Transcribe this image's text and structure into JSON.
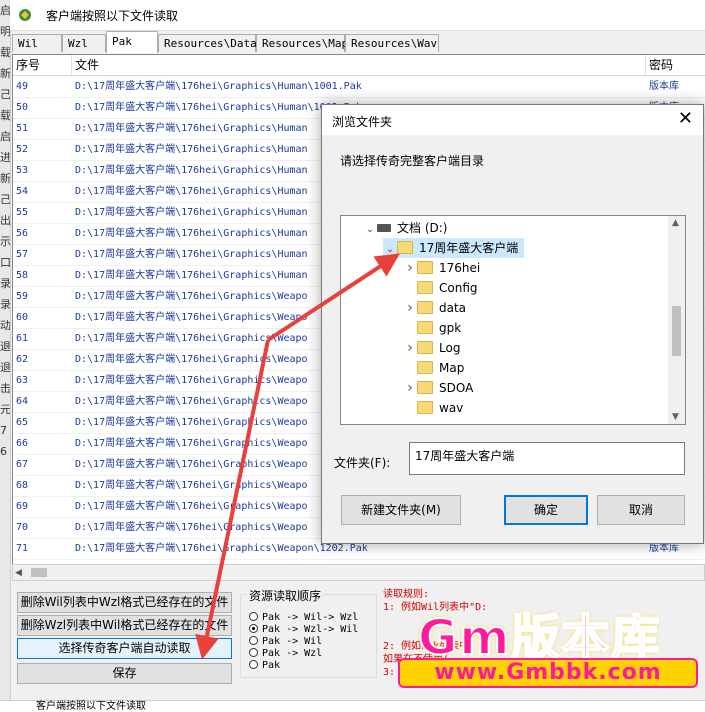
{
  "window": {
    "title": "客户端按照以下文件读取"
  },
  "left_fragments": [
    "启",
    "明",
    "载",
    "新",
    "己",
    "载",
    "启",
    "进",
    "新",
    "己",
    "出",
    "示",
    "口",
    "录",
    "录",
    "动",
    "退",
    "退",
    "击",
    "元",
    "7",
    "6"
  ],
  "tabs": [
    {
      "label": "Wil",
      "active": false
    },
    {
      "label": "Wzl",
      "active": false
    },
    {
      "label": "Pak",
      "active": true
    },
    {
      "label": "Resources\\Data",
      "active": false
    },
    {
      "label": "Resources\\Map",
      "active": false
    },
    {
      "label": "Resources\\Wav",
      "active": false
    }
  ],
  "grid": {
    "columns": [
      "序号",
      "文件",
      "密码"
    ],
    "rows": [
      {
        "no": "49",
        "file": "D:\\17周年盛大客户端\\176hei\\Graphics\\Human\\1001.Pak",
        "pwd": "版本库"
      },
      {
        "no": "50",
        "file": "D:\\17周年盛大客户端\\176hei\\Graphics\\Human\\1002.Pak",
        "pwd": "版本库"
      },
      {
        "no": "51",
        "file": "D:\\17周年盛大客户端\\176hei\\Graphics\\Human",
        "pwd": ""
      },
      {
        "no": "52",
        "file": "D:\\17周年盛大客户端\\176hei\\Graphics\\Human",
        "pwd": ""
      },
      {
        "no": "53",
        "file": "D:\\17周年盛大客户端\\176hei\\Graphics\\Human",
        "pwd": ""
      },
      {
        "no": "54",
        "file": "D:\\17周年盛大客户端\\176hei\\Graphics\\Human",
        "pwd": ""
      },
      {
        "no": "55",
        "file": "D:\\17周年盛大客户端\\176hei\\Graphics\\Human",
        "pwd": ""
      },
      {
        "no": "56",
        "file": "D:\\17周年盛大客户端\\176hei\\Graphics\\Human",
        "pwd": ""
      },
      {
        "no": "57",
        "file": "D:\\17周年盛大客户端\\176hei\\Graphics\\Human",
        "pwd": ""
      },
      {
        "no": "58",
        "file": "D:\\17周年盛大客户端\\176hei\\Graphics\\Human",
        "pwd": ""
      },
      {
        "no": "59",
        "file": "D:\\17周年盛大客户端\\176hei\\Graphics\\Weapo",
        "pwd": ""
      },
      {
        "no": "60",
        "file": "D:\\17周年盛大客户端\\176hei\\Graphics\\Weapo",
        "pwd": ""
      },
      {
        "no": "61",
        "file": "D:\\17周年盛大客户端\\176hei\\Graphics\\Weapo",
        "pwd": ""
      },
      {
        "no": "62",
        "file": "D:\\17周年盛大客户端\\176hei\\Graphics\\Weapo",
        "pwd": ""
      },
      {
        "no": "63",
        "file": "D:\\17周年盛大客户端\\176hei\\Graphics\\Weapo",
        "pwd": ""
      },
      {
        "no": "64",
        "file": "D:\\17周年盛大客户端\\176hei\\Graphics\\Weapo",
        "pwd": ""
      },
      {
        "no": "65",
        "file": "D:\\17周年盛大客户端\\176hei\\Graphics\\Weapo",
        "pwd": ""
      },
      {
        "no": "66",
        "file": "D:\\17周年盛大客户端\\176hei\\Graphics\\Weapo",
        "pwd": ""
      },
      {
        "no": "67",
        "file": "D:\\17周年盛大客户端\\176hei\\Graphics\\Weapo",
        "pwd": ""
      },
      {
        "no": "68",
        "file": "D:\\17周年盛大客户端\\176hei\\Graphics\\Weapo",
        "pwd": ""
      },
      {
        "no": "69",
        "file": "D:\\17周年盛大客户端\\176hei\\Graphics\\Weapo",
        "pwd": ""
      },
      {
        "no": "70",
        "file": "D:\\17周年盛大客户端\\176hei\\Graphics\\Weapo",
        "pwd": ""
      },
      {
        "no": "71",
        "file": "D:\\17周年盛大客户端\\176hei\\Graphics\\Weapon\\1202.Pak",
        "pwd": "版本库"
      }
    ]
  },
  "buttons": {
    "delete_wil": "删除Wil列表中Wzl格式已经存在的文件",
    "delete_wzl": "删除Wzl列表中Wil格式已经存在的文件",
    "auto_read": "选择传奇客户端自动读取",
    "save": "保存"
  },
  "resource_order": {
    "title": "资源读取顺序",
    "options": [
      {
        "label": "Pak -> Wil-> Wzl",
        "checked": false
      },
      {
        "label": "Pak -> Wzl-> Wil",
        "checked": true
      },
      {
        "label": "Pak -> Wil",
        "checked": false
      },
      {
        "label": "Pak -> Wzl",
        "checked": false
      },
      {
        "label": "Pak",
        "checked": false
      }
    ]
  },
  "rules": {
    "lines": [
      "读取规则:",
      "1: 例如Wil列表中\"D:",
      "",
      "",
      "2: 例如Pak列表中",
      "   如果在不使用(",
      "3:"
    ]
  },
  "watermark": {
    "line1": "Gm版本库",
    "line2": "www.Gmbbk.com"
  },
  "dialog": {
    "title": "浏览文件夹",
    "close": "✕",
    "prompt": "请选择传奇完整客户端目录",
    "tree": [
      {
        "label": "文档 (D:)",
        "level": 0,
        "expanded": true,
        "type": "drive"
      },
      {
        "label": "17周年盛大客户端",
        "level": 1,
        "expanded": true,
        "type": "folder",
        "selected": true
      },
      {
        "label": "176hei",
        "level": 2,
        "expanded": false,
        "type": "folder",
        "has_children": true
      },
      {
        "label": "Config",
        "level": 2,
        "type": "folder",
        "has_children": false
      },
      {
        "label": "data",
        "level": 2,
        "type": "folder",
        "has_children": true
      },
      {
        "label": "gpk",
        "level": 2,
        "type": "folder",
        "has_children": false
      },
      {
        "label": "Log",
        "level": 2,
        "type": "folder",
        "has_children": true
      },
      {
        "label": "Map",
        "level": 2,
        "type": "folder",
        "has_children": false
      },
      {
        "label": "SDOA",
        "level": 2,
        "type": "folder",
        "has_children": true
      },
      {
        "label": "wav",
        "level": 2,
        "type": "folder",
        "has_children": false
      }
    ],
    "folder_label": "文件夹(F):",
    "folder_value": "17周年盛大客户端",
    "new_folder": "新建文件夹(M)",
    "ok": "确定",
    "cancel": "取消"
  },
  "bottom_title": "客户端按照以下文件读取",
  "colors": {
    "accent": "#0078d7",
    "link_text": "#1d3a9c",
    "rules_text": "#d40000",
    "arrow": "#e8413b",
    "watermark_pink": "#ff1a9c",
    "watermark_yellow": "#ffd200"
  }
}
